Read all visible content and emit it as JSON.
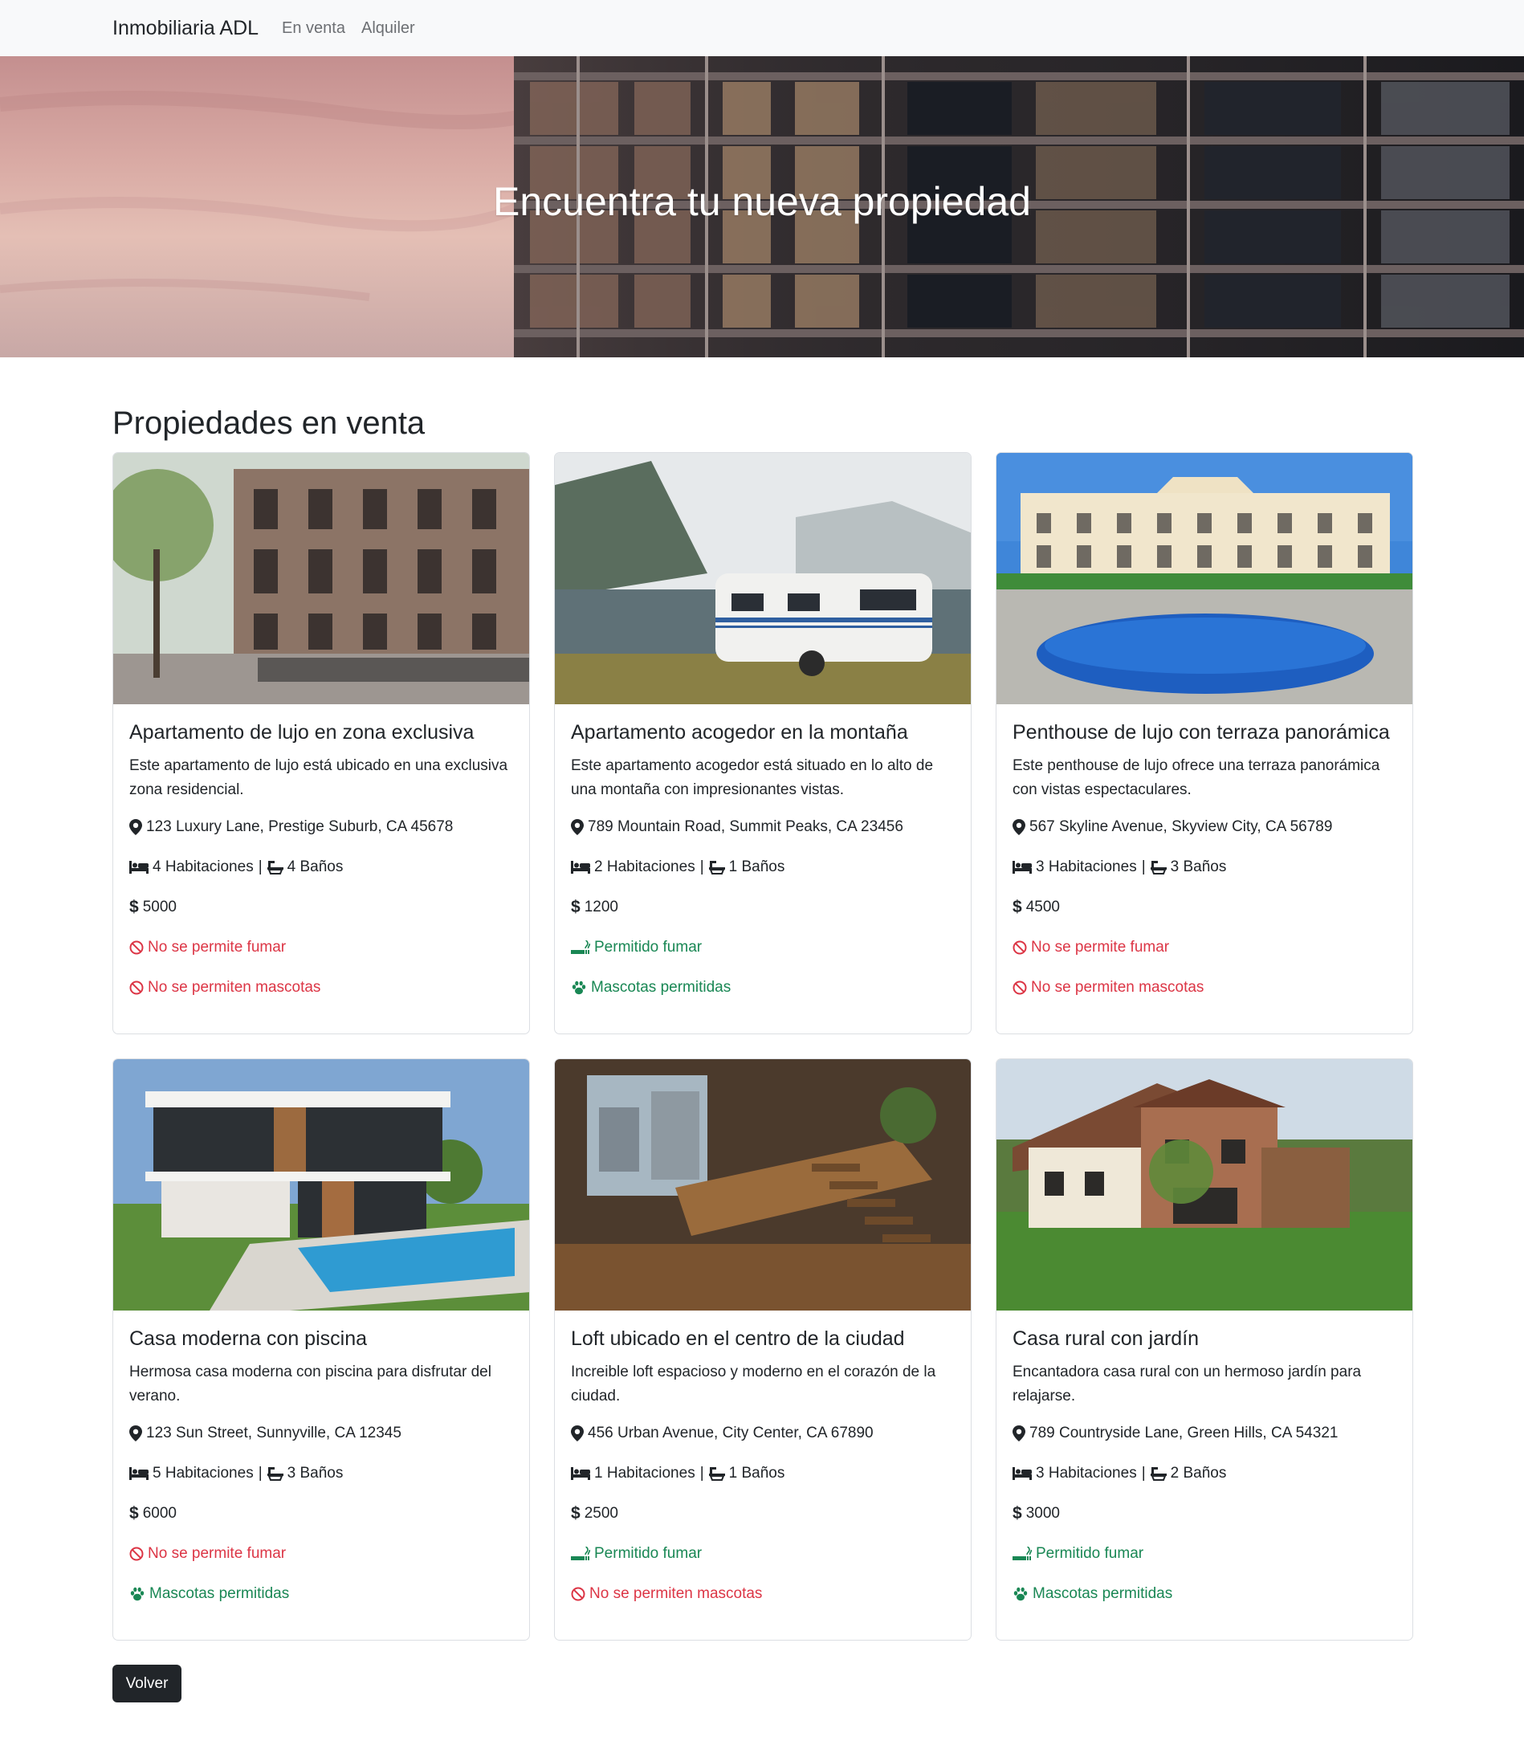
{
  "nav": {
    "brand": "Inmobiliaria ADL",
    "links": [
      "En venta",
      "Alquiler"
    ]
  },
  "hero": {
    "title": "Encuentra tu nueva propiedad"
  },
  "main": {
    "section_title": "Propiedades en venta",
    "back_label": "Volver"
  },
  "properties": [
    {
      "title": "Apartamento de lujo en zona exclusiva",
      "description": "Este apartamento de lujo está ubicado en una exclusiva zona residencial.",
      "address": "123 Luxury Lane, Prestige Suburb, CA 45678",
      "rooms": "4 Habitaciones",
      "baths": "4 Baños",
      "price": "5000",
      "smoking": "No se permite fumar",
      "smoking_allowed": false,
      "pets": "No se permiten mascotas",
      "pets_allowed": false
    },
    {
      "title": "Apartamento acogedor en la montaña",
      "description": "Este apartamento acogedor está situado en lo alto de una montaña con impresionantes vistas.",
      "address": "789 Mountain Road, Summit Peaks, CA 23456",
      "rooms": "2 Habitaciones",
      "baths": "1 Baños",
      "price": "1200",
      "smoking": "Permitido fumar",
      "smoking_allowed": true,
      "pets": "Mascotas permitidas",
      "pets_allowed": true
    },
    {
      "title": "Penthouse de lujo con terraza panorámica",
      "description": "Este penthouse de lujo ofrece una terraza panorámica con vistas espectaculares.",
      "address": "567 Skyline Avenue, Skyview City, CA 56789",
      "rooms": "3 Habitaciones",
      "baths": "3 Baños",
      "price": "4500",
      "smoking": "No se permite fumar",
      "smoking_allowed": false,
      "pets": "No se permiten mascotas",
      "pets_allowed": false
    },
    {
      "title": "Casa moderna con piscina",
      "description": "Hermosa casa moderna con piscina para disfrutar del verano.",
      "address": "123 Sun Street, Sunnyville, CA 12345",
      "rooms": "5 Habitaciones",
      "baths": "3 Baños",
      "price": "6000",
      "smoking": "No se permite fumar",
      "smoking_allowed": false,
      "pets": "Mascotas permitidas",
      "pets_allowed": true
    },
    {
      "title": "Loft ubicado en el centro de la ciudad",
      "description": "Increible loft espacioso y moderno en el corazón de la ciudad.",
      "address": "456 Urban Avenue, City Center, CA 67890",
      "rooms": "1 Habitaciones",
      "baths": "1 Baños",
      "price": "2500",
      "smoking": "Permitido fumar",
      "smoking_allowed": true,
      "pets": "No se permiten mascotas",
      "pets_allowed": false
    },
    {
      "title": "Casa rural con jardín",
      "description": "Encantadora casa rural con un hermoso jardín para relajarse.",
      "address": "789 Countryside Lane, Green Hills, CA 54321",
      "rooms": "3 Habitaciones",
      "baths": "2 Baños",
      "price": "3000",
      "smoking": "Permitido fumar",
      "smoking_allowed": true,
      "pets": "Mascotas permitidas",
      "pets_allowed": true
    }
  ],
  "colors": {
    "danger": "#dc3545",
    "success": "#198754",
    "dark": "#212529"
  }
}
